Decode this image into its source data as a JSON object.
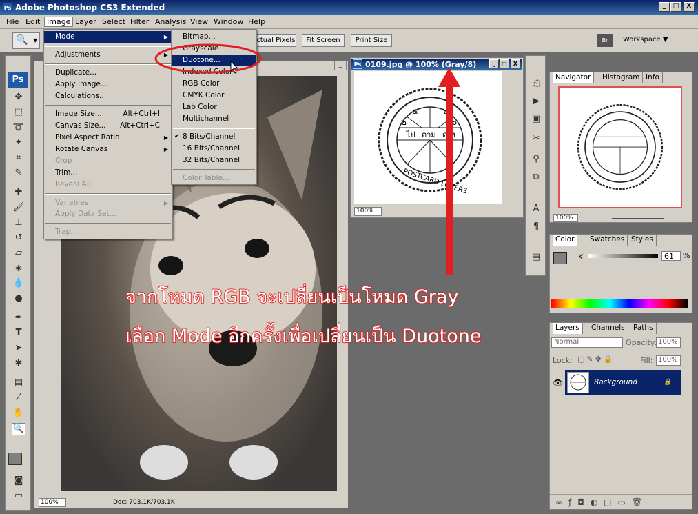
{
  "app": {
    "title": "Adobe Photoshop CS3 Extended",
    "icon": "Ps"
  },
  "window_controls": {
    "min": "_",
    "max": "□",
    "close": "X"
  },
  "menubar": [
    "File",
    "Edit",
    "Image",
    "Layer",
    "Select",
    "Filter",
    "Analysis",
    "View",
    "Window",
    "Help"
  ],
  "options_bar": {
    "actual_pixels": "Actual Pixels",
    "fit_screen": "Fit Screen",
    "print_size": "Print Size",
    "workspace": "Workspace ▼"
  },
  "image_menu": {
    "items": [
      {
        "label": "Mode",
        "arrow": "▶"
      },
      {
        "label": "Adjustments",
        "arrow": "▶"
      },
      {
        "label": "Duplicate..."
      },
      {
        "label": "Apply Image..."
      },
      {
        "label": "Calculations..."
      },
      {
        "label": "Image Size...",
        "shortcut": "Alt+Ctrl+I"
      },
      {
        "label": "Canvas Size...",
        "shortcut": "Alt+Ctrl+C"
      },
      {
        "label": "Pixel Aspect Ratio",
        "arrow": "▶"
      },
      {
        "label": "Rotate Canvas",
        "arrow": "▶"
      },
      {
        "label": "Crop"
      },
      {
        "label": "Trim..."
      },
      {
        "label": "Reveal All"
      },
      {
        "label": "Variables",
        "arrow": "▶"
      },
      {
        "label": "Apply Data Set..."
      },
      {
        "label": "Trap..."
      }
    ]
  },
  "mode_menu": {
    "items": [
      {
        "label": "Bitmap..."
      },
      {
        "label": "Grayscale",
        "check": "✔"
      },
      {
        "label": "Duotone..."
      },
      {
        "label": "Indexed Color"
      },
      {
        "label": "RGB Color"
      },
      {
        "label": "CMYK Color"
      },
      {
        "label": "Lab Color"
      },
      {
        "label": "Multichannel"
      },
      {
        "label": "8 Bits/Channel",
        "check": "✔"
      },
      {
        "label": "16 Bits/Channel"
      },
      {
        "label": "32 Bits/Channel"
      },
      {
        "label": "Color Table..."
      }
    ]
  },
  "doc_dog": {
    "zoom": "100%",
    "doc": "Doc: 703.1K/703.1K"
  },
  "doc_stamp": {
    "title": "0109.jpg @ 100% (Gray/8)",
    "zoom": "100%"
  },
  "stamp": {
    "digits_top": [
      "๕",
      "๖"
    ],
    "digits_side": [
      "๒",
      "๐"
    ],
    "words": [
      "ไป",
      "ตาม",
      "ดวง"
    ],
    "ring": "POSTCARD LOVERS"
  },
  "navigator": {
    "tabs": [
      "Navigator",
      "Histogram",
      "Info"
    ],
    "zoom": "100%"
  },
  "color_panel": {
    "tabs": [
      "Color",
      "Swatches",
      "Styles"
    ],
    "channel": "K",
    "value": "61",
    "unit": "%"
  },
  "layers_panel": {
    "tabs": [
      "Layers",
      "Channels",
      "Paths"
    ],
    "blend": "Normal",
    "opacity_label": "Opacity:",
    "opacity": "100%",
    "lock_label": "Lock:",
    "fill_label": "Fill:",
    "fill": "100%",
    "layer_name": "Background"
  },
  "annotation": {
    "line1": "จากโหมด RGB จะเปลี่ยนเป็นโหมด Gray",
    "line2": "เลือก Mode อีกครั้งเพื่อเปลี่ยนเป็น Duotone"
  },
  "colors": {
    "highlight": "#0a246a",
    "annotation_red": "#e02020"
  }
}
